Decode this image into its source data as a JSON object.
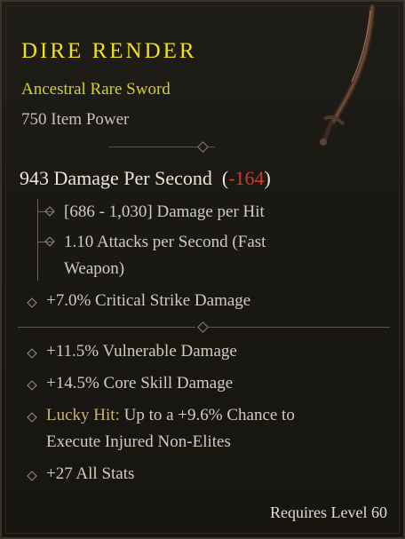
{
  "item": {
    "name": "DIRE RENDER",
    "type": "Ancestral Rare Sword",
    "power": "750 Item Power",
    "dps_value": "943 Damage Per Second",
    "dps_open": "(",
    "dps_diff": "-164",
    "dps_close": ")",
    "damage_per_hit": "[686 - 1,030] Damage per Hit",
    "attacks_line1": "1.10 Attacks per Second (Fast",
    "attacks_line2": "Weapon)",
    "implicit": "+7.0% Critical Strike Damage",
    "affixes": [
      "+11.5% Vulnerable Damage",
      "+14.5% Core Skill Damage"
    ],
    "lucky_label": "Lucky Hit:",
    "lucky_text1": " Up to a +9.6% Chance to",
    "lucky_text2": "Execute Injured Non-Elites",
    "last_affix": "+27 All Stats",
    "requirement": "Requires Level 60"
  },
  "colors": {
    "title": "#f2e21e",
    "rarity": "#d6cf2c",
    "negative": "#d43a2a",
    "lucky": "#c7b36a"
  },
  "icons": [
    "sword-icon",
    "diamond-bullet-icon",
    "divider-diamond-icon"
  ]
}
